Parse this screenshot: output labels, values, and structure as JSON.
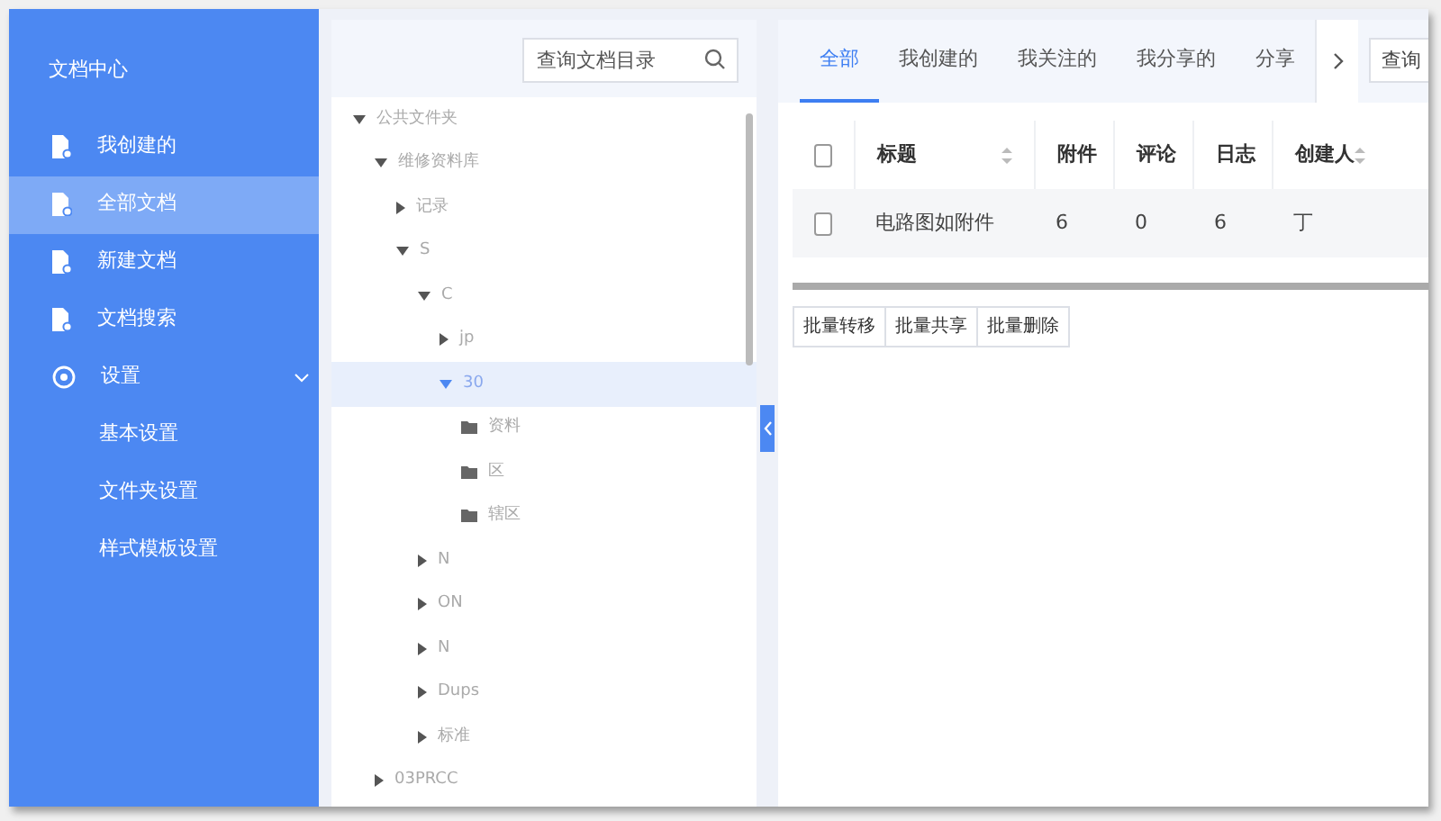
{
  "sidebar": {
    "title": "文档中心",
    "items": [
      {
        "label": "我创建的",
        "kind": "doc",
        "selected": false
      },
      {
        "label": "全部文档",
        "kind": "doc",
        "selected": true
      },
      {
        "label": "新建文档",
        "kind": "doc",
        "selected": false
      },
      {
        "label": "文档搜索",
        "kind": "doc",
        "selected": false
      },
      {
        "label": "设置",
        "kind": "settings",
        "selected": false,
        "expanded": true,
        "children": [
          {
            "label": "基本设置"
          },
          {
            "label": "文件夹设置"
          },
          {
            "label": "样式模板设置"
          }
        ]
      }
    ]
  },
  "tree": {
    "search": {
      "placeholder": "查询文档目录"
    },
    "items": [
      {
        "label": "公共文件夹",
        "kind": "folder",
        "expanded": true,
        "selected": false,
        "children": [
          {
            "label": "维修资料库",
            "kind": "folder",
            "expanded": true,
            "selected": false,
            "children": [
              {
                "label": "记录",
                "kind": "folder",
                "expanded": false,
                "selected": false
              },
              {
                "label": "S",
                "kind": "folder",
                "expanded": true,
                "selected": false,
                "children": [
                  {
                    "label": "C",
                    "kind": "folder",
                    "expanded": true,
                    "selected": false,
                    "children": [
                      {
                        "label": "jp",
                        "kind": "folder",
                        "expanded": false,
                        "selected": false
                      },
                      {
                        "label": "30",
                        "kind": "folder",
                        "expanded": true,
                        "selected": true,
                        "children": [
                          {
                            "label": "资料",
                            "kind": "file",
                            "selected": false
                          },
                          {
                            "label": "区",
                            "kind": "file",
                            "selected": false
                          },
                          {
                            "label": "辖区",
                            "kind": "file",
                            "selected": false
                          }
                        ]
                      }
                    ]
                  },
                  {
                    "label": "N",
                    "kind": "folder",
                    "expanded": false,
                    "selected": false
                  },
                  {
                    "label": "ON",
                    "kind": "folder",
                    "expanded": false,
                    "selected": false
                  },
                  {
                    "label": "N",
                    "kind": "folder",
                    "expanded": false,
                    "selected": false
                  },
                  {
                    "label": "Dups",
                    "kind": "folder",
                    "expanded": false,
                    "selected": false
                  },
                  {
                    "label": "标准",
                    "kind": "folder",
                    "expanded": false,
                    "selected": false
                  }
                ]
              }
            ]
          },
          {
            "label": "03PRCC",
            "kind": "folder",
            "expanded": false,
            "selected": false
          }
        ]
      }
    ]
  },
  "tabs": [
    {
      "label": "全部",
      "selected": true
    },
    {
      "label": "我创建的",
      "selected": false
    },
    {
      "label": "我关注的",
      "selected": false
    },
    {
      "label": "我分享的",
      "selected": false
    },
    {
      "label": "分享",
      "selected": false
    }
  ],
  "search": {
    "placeholder": "查询"
  },
  "table": {
    "all_checked": false,
    "columns": [
      {
        "label": "标题",
        "sortable": true
      },
      {
        "label": "附件",
        "sortable": false
      },
      {
        "label": "评论",
        "sortable": false
      },
      {
        "label": "日志",
        "sortable": false
      },
      {
        "label": "创建人",
        "sortable": true
      }
    ],
    "rows": [
      {
        "checked": false,
        "cells": [
          "电路图如附件",
          "6",
          "0",
          "6",
          "丁"
        ]
      }
    ]
  },
  "buttons": [
    "批量转移",
    "批量共享",
    "批量删除"
  ]
}
